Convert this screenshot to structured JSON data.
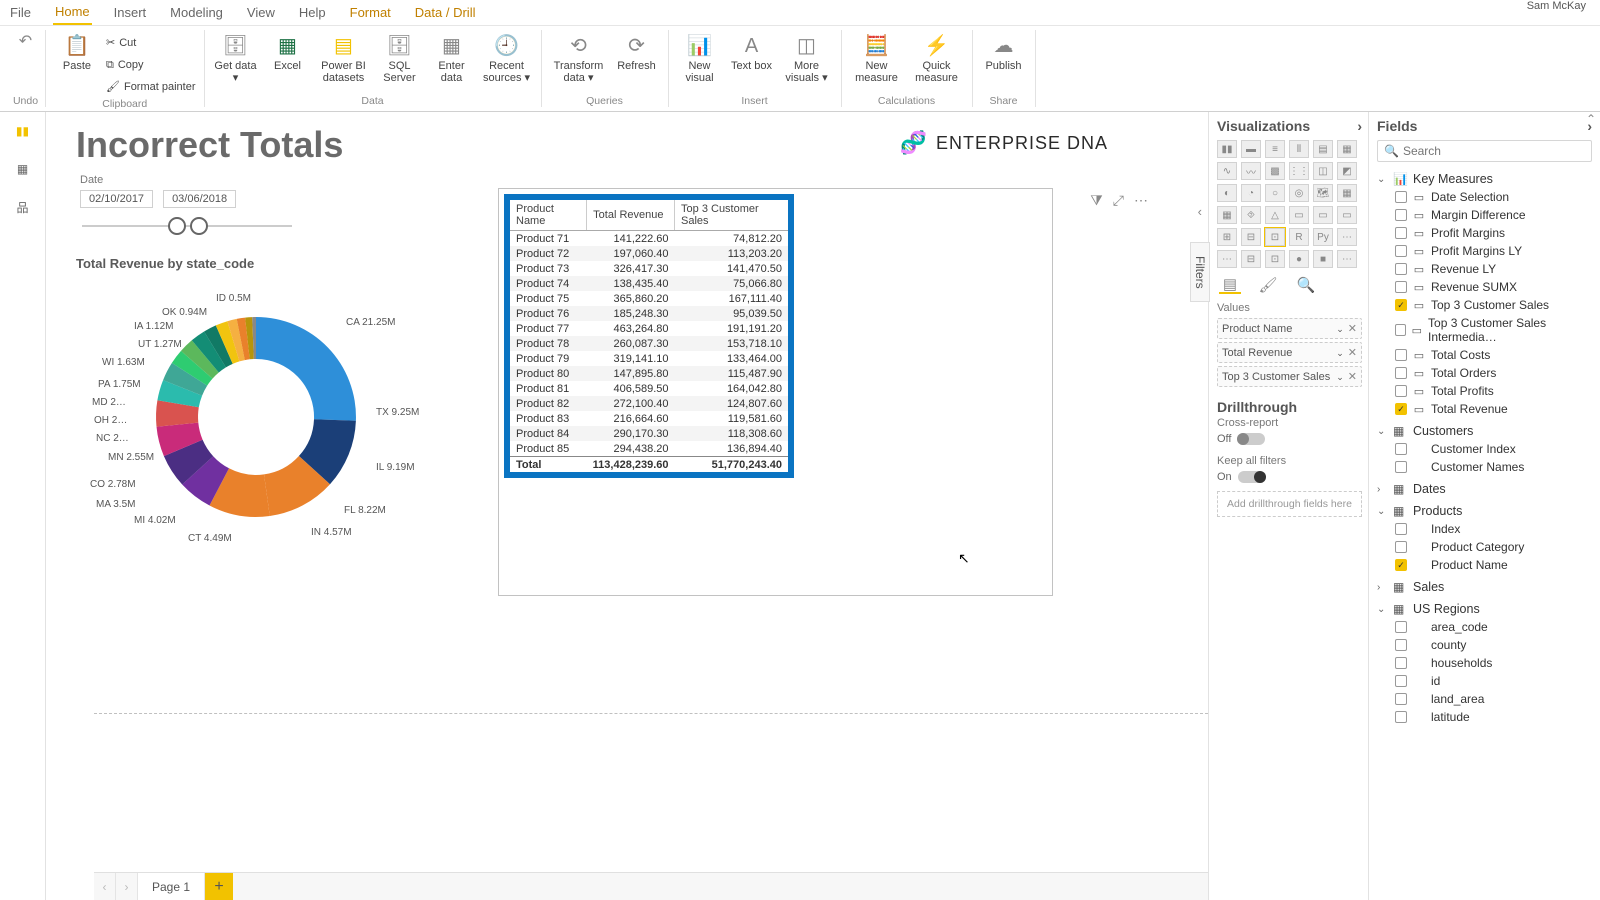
{
  "user": "Sam McKay",
  "menu": {
    "items": [
      "File",
      "Home",
      "Insert",
      "Modeling",
      "View",
      "Help",
      "Format",
      "Data / Drill"
    ],
    "active": "Home"
  },
  "ribbon": {
    "undo": "Undo",
    "clipboard": {
      "label": "Clipboard",
      "paste": "Paste",
      "cut": "Cut",
      "copy": "Copy",
      "format_painter": "Format painter"
    },
    "data": {
      "label": "Data",
      "get": "Get data ▾",
      "excel": "Excel",
      "pbi": "Power BI datasets",
      "sql": "SQL Server",
      "enter": "Enter data",
      "recent": "Recent sources ▾"
    },
    "queries": {
      "label": "Queries",
      "transform": "Transform data ▾",
      "refresh": "Refresh"
    },
    "insert": {
      "label": "Insert",
      "visual": "New visual",
      "text": "Text box",
      "more": "More visuals ▾"
    },
    "calc": {
      "label": "Calculations",
      "measure": "New measure",
      "quick": "Quick measure"
    },
    "share": {
      "label": "Share",
      "publish": "Publish"
    }
  },
  "report": {
    "title": "Incorrect Totals",
    "brand": "ENTERPRISE DNA",
    "date_label": "Date",
    "date_from": "02/10/2017",
    "date_to": "03/06/2018",
    "chart_title": "Total Revenue by state_code",
    "filters_tab": "Filters"
  },
  "chart_data": {
    "type": "pie",
    "title": "Total Revenue by state_code",
    "slices": [
      {
        "label": "CA 21.25M",
        "value": 21.25,
        "color": "#2E8FD9"
      },
      {
        "label": "TX 9.25M",
        "value": 9.25,
        "color": "#1b3f78"
      },
      {
        "label": "IL 9.19M",
        "value": 9.19,
        "color": "#E9812B"
      },
      {
        "label": "FL 8.22M",
        "value": 8.22,
        "color": "#E9812B"
      },
      {
        "label": "IN 4.57M",
        "value": 4.57,
        "color": "#7030A0"
      },
      {
        "label": "CT 4.49M",
        "value": 4.49,
        "color": "#4B2E83"
      },
      {
        "label": "MI 4.02M",
        "value": 4.02,
        "color": "#C92B7A"
      },
      {
        "label": "MA 3.5M",
        "value": 3.5,
        "color": "#D9534F"
      },
      {
        "label": "CO 2.78M",
        "value": 2.78,
        "color": "#2BBBAD"
      },
      {
        "label": "MN 2.55M",
        "value": 2.55,
        "color": "#3FA796"
      },
      {
        "label": "NC 2…",
        "value": 2.0,
        "color": "#2ECC71"
      },
      {
        "label": "OH 2…",
        "value": 2.0,
        "color": "#5CB85C"
      },
      {
        "label": "MD 2…",
        "value": 2.0,
        "color": "#138D75"
      },
      {
        "label": "PA 1.75M",
        "value": 1.75,
        "color": "#117A65"
      },
      {
        "label": "WI 1.63M",
        "value": 1.63,
        "color": "#F1C40F"
      },
      {
        "label": "UT 1.27M",
        "value": 1.27,
        "color": "#F5B041"
      },
      {
        "label": "IA 1.12M",
        "value": 1.12,
        "color": "#E9812B"
      },
      {
        "label": "OK 0.94M",
        "value": 0.94,
        "color": "#B7950B"
      },
      {
        "label": "ID 0.5M",
        "value": 0.5,
        "color": "#888"
      }
    ]
  },
  "table": {
    "cols": [
      "Product Name",
      "Total Revenue",
      "Top 3 Customer Sales"
    ],
    "rows": [
      [
        "Product 71",
        "141,222.60",
        "74,812.20"
      ],
      [
        "Product 72",
        "197,060.40",
        "113,203.20"
      ],
      [
        "Product 73",
        "326,417.30",
        "141,470.50"
      ],
      [
        "Product 74",
        "138,435.40",
        "75,066.80"
      ],
      [
        "Product 75",
        "365,860.20",
        "167,111.40"
      ],
      [
        "Product 76",
        "185,248.30",
        "95,039.50"
      ],
      [
        "Product 77",
        "463,264.80",
        "191,191.20"
      ],
      [
        "Product 78",
        "260,087.30",
        "153,718.10"
      ],
      [
        "Product 79",
        "319,141.10",
        "133,464.00"
      ],
      [
        "Product 80",
        "147,895.80",
        "115,487.90"
      ],
      [
        "Product 81",
        "406,589.50",
        "164,042.80"
      ],
      [
        "Product 82",
        "272,100.40",
        "124,807.60"
      ],
      [
        "Product 83",
        "216,664.60",
        "119,581.60"
      ],
      [
        "Product 84",
        "290,170.30",
        "118,308.60"
      ],
      [
        "Product 85",
        "294,438.20",
        "136,894.40"
      ]
    ],
    "total": [
      "Total",
      "113,428,239.60",
      "51,770,243.40"
    ]
  },
  "viz_pane": {
    "title": "Visualizations",
    "values_label": "Values",
    "wells": [
      "Product Name",
      "Total Revenue",
      "Top 3 Customer Sales"
    ],
    "drill_title": "Drillthrough",
    "cross": "Cross-report",
    "cross_state": "Off",
    "keep": "Keep all filters",
    "keep_state": "On",
    "drop": "Add drillthrough fields here"
  },
  "fields_pane": {
    "title": "Fields",
    "search_ph": "Search",
    "tables": [
      {
        "name": "Key Measures",
        "open": true,
        "icon": "📊",
        "fields": [
          {
            "n": "Date Selection",
            "c": false,
            "i": "▭"
          },
          {
            "n": "Margin Difference",
            "c": false,
            "i": "▭"
          },
          {
            "n": "Profit Margins",
            "c": false,
            "i": "▭"
          },
          {
            "n": "Profit Margins LY",
            "c": false,
            "i": "▭"
          },
          {
            "n": "Revenue LY",
            "c": false,
            "i": "▭"
          },
          {
            "n": "Revenue SUMX",
            "c": false,
            "i": "▭"
          },
          {
            "n": "Top 3 Customer Sales",
            "c": true,
            "i": "▭"
          },
          {
            "n": "Top 3 Customer Sales Intermedia…",
            "c": false,
            "i": "▭"
          },
          {
            "n": "Total Costs",
            "c": false,
            "i": "▭"
          },
          {
            "n": "Total Orders",
            "c": false,
            "i": "▭"
          },
          {
            "n": "Total Profits",
            "c": false,
            "i": "▭"
          },
          {
            "n": "Total Revenue",
            "c": true,
            "i": "▭"
          }
        ]
      },
      {
        "name": "Customers",
        "open": true,
        "icon": "▦",
        "fields": [
          {
            "n": "Customer Index",
            "c": false,
            "i": ""
          },
          {
            "n": "Customer Names",
            "c": false,
            "i": ""
          }
        ]
      },
      {
        "name": "Dates",
        "open": false,
        "icon": "▦",
        "fields": []
      },
      {
        "name": "Products",
        "open": true,
        "icon": "▦",
        "fields": [
          {
            "n": "Index",
            "c": false,
            "i": ""
          },
          {
            "n": "Product Category",
            "c": false,
            "i": ""
          },
          {
            "n": "Product Name",
            "c": true,
            "i": ""
          }
        ]
      },
      {
        "name": "Sales",
        "open": false,
        "icon": "▦",
        "fields": []
      },
      {
        "name": "US Regions",
        "open": true,
        "icon": "▦",
        "fields": [
          {
            "n": "area_code",
            "c": false,
            "i": ""
          },
          {
            "n": "county",
            "c": false,
            "i": ""
          },
          {
            "n": "households",
            "c": false,
            "i": ""
          },
          {
            "n": "id",
            "c": false,
            "i": ""
          },
          {
            "n": "land_area",
            "c": false,
            "i": ""
          },
          {
            "n": "latitude",
            "c": false,
            "i": ""
          }
        ]
      }
    ]
  },
  "pages": {
    "nav_prev": "‹",
    "nav_next": "›",
    "tab": "Page 1",
    "add": "+"
  }
}
